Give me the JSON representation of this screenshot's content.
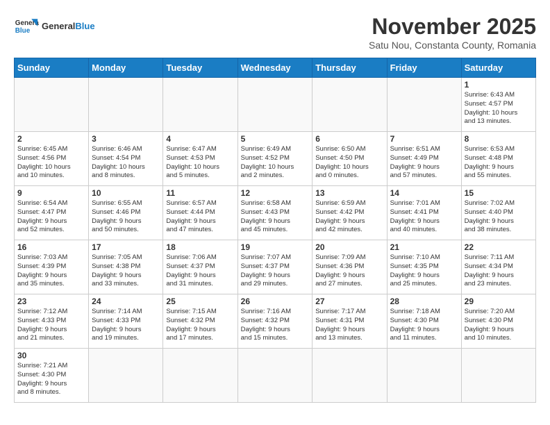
{
  "logo": {
    "text_general": "General",
    "text_blue": "Blue"
  },
  "title": "November 2025",
  "subtitle": "Satu Nou, Constanta County, Romania",
  "days_of_week": [
    "Sunday",
    "Monday",
    "Tuesday",
    "Wednesday",
    "Thursday",
    "Friday",
    "Saturday"
  ],
  "weeks": [
    [
      {
        "day": "",
        "info": ""
      },
      {
        "day": "",
        "info": ""
      },
      {
        "day": "",
        "info": ""
      },
      {
        "day": "",
        "info": ""
      },
      {
        "day": "",
        "info": ""
      },
      {
        "day": "",
        "info": ""
      },
      {
        "day": "1",
        "info": "Sunrise: 6:43 AM\nSunset: 4:57 PM\nDaylight: 10 hours\nand 13 minutes."
      }
    ],
    [
      {
        "day": "2",
        "info": "Sunrise: 6:45 AM\nSunset: 4:56 PM\nDaylight: 10 hours\nand 10 minutes."
      },
      {
        "day": "3",
        "info": "Sunrise: 6:46 AM\nSunset: 4:54 PM\nDaylight: 10 hours\nand 8 minutes."
      },
      {
        "day": "4",
        "info": "Sunrise: 6:47 AM\nSunset: 4:53 PM\nDaylight: 10 hours\nand 5 minutes."
      },
      {
        "day": "5",
        "info": "Sunrise: 6:49 AM\nSunset: 4:52 PM\nDaylight: 10 hours\nand 2 minutes."
      },
      {
        "day": "6",
        "info": "Sunrise: 6:50 AM\nSunset: 4:50 PM\nDaylight: 10 hours\nand 0 minutes."
      },
      {
        "day": "7",
        "info": "Sunrise: 6:51 AM\nSunset: 4:49 PM\nDaylight: 9 hours\nand 57 minutes."
      },
      {
        "day": "8",
        "info": "Sunrise: 6:53 AM\nSunset: 4:48 PM\nDaylight: 9 hours\nand 55 minutes."
      }
    ],
    [
      {
        "day": "9",
        "info": "Sunrise: 6:54 AM\nSunset: 4:47 PM\nDaylight: 9 hours\nand 52 minutes."
      },
      {
        "day": "10",
        "info": "Sunrise: 6:55 AM\nSunset: 4:46 PM\nDaylight: 9 hours\nand 50 minutes."
      },
      {
        "day": "11",
        "info": "Sunrise: 6:57 AM\nSunset: 4:44 PM\nDaylight: 9 hours\nand 47 minutes."
      },
      {
        "day": "12",
        "info": "Sunrise: 6:58 AM\nSunset: 4:43 PM\nDaylight: 9 hours\nand 45 minutes."
      },
      {
        "day": "13",
        "info": "Sunrise: 6:59 AM\nSunset: 4:42 PM\nDaylight: 9 hours\nand 42 minutes."
      },
      {
        "day": "14",
        "info": "Sunrise: 7:01 AM\nSunset: 4:41 PM\nDaylight: 9 hours\nand 40 minutes."
      },
      {
        "day": "15",
        "info": "Sunrise: 7:02 AM\nSunset: 4:40 PM\nDaylight: 9 hours\nand 38 minutes."
      }
    ],
    [
      {
        "day": "16",
        "info": "Sunrise: 7:03 AM\nSunset: 4:39 PM\nDaylight: 9 hours\nand 35 minutes."
      },
      {
        "day": "17",
        "info": "Sunrise: 7:05 AM\nSunset: 4:38 PM\nDaylight: 9 hours\nand 33 minutes."
      },
      {
        "day": "18",
        "info": "Sunrise: 7:06 AM\nSunset: 4:37 PM\nDaylight: 9 hours\nand 31 minutes."
      },
      {
        "day": "19",
        "info": "Sunrise: 7:07 AM\nSunset: 4:37 PM\nDaylight: 9 hours\nand 29 minutes."
      },
      {
        "day": "20",
        "info": "Sunrise: 7:09 AM\nSunset: 4:36 PM\nDaylight: 9 hours\nand 27 minutes."
      },
      {
        "day": "21",
        "info": "Sunrise: 7:10 AM\nSunset: 4:35 PM\nDaylight: 9 hours\nand 25 minutes."
      },
      {
        "day": "22",
        "info": "Sunrise: 7:11 AM\nSunset: 4:34 PM\nDaylight: 9 hours\nand 23 minutes."
      }
    ],
    [
      {
        "day": "23",
        "info": "Sunrise: 7:12 AM\nSunset: 4:33 PM\nDaylight: 9 hours\nand 21 minutes."
      },
      {
        "day": "24",
        "info": "Sunrise: 7:14 AM\nSunset: 4:33 PM\nDaylight: 9 hours\nand 19 minutes."
      },
      {
        "day": "25",
        "info": "Sunrise: 7:15 AM\nSunset: 4:32 PM\nDaylight: 9 hours\nand 17 minutes."
      },
      {
        "day": "26",
        "info": "Sunrise: 7:16 AM\nSunset: 4:32 PM\nDaylight: 9 hours\nand 15 minutes."
      },
      {
        "day": "27",
        "info": "Sunrise: 7:17 AM\nSunset: 4:31 PM\nDaylight: 9 hours\nand 13 minutes."
      },
      {
        "day": "28",
        "info": "Sunrise: 7:18 AM\nSunset: 4:30 PM\nDaylight: 9 hours\nand 11 minutes."
      },
      {
        "day": "29",
        "info": "Sunrise: 7:20 AM\nSunset: 4:30 PM\nDaylight: 9 hours\nand 10 minutes."
      }
    ],
    [
      {
        "day": "30",
        "info": "Sunrise: 7:21 AM\nSunset: 4:30 PM\nDaylight: 9 hours\nand 8 minutes."
      },
      {
        "day": "",
        "info": ""
      },
      {
        "day": "",
        "info": ""
      },
      {
        "day": "",
        "info": ""
      },
      {
        "day": "",
        "info": ""
      },
      {
        "day": "",
        "info": ""
      },
      {
        "day": "",
        "info": ""
      }
    ]
  ]
}
